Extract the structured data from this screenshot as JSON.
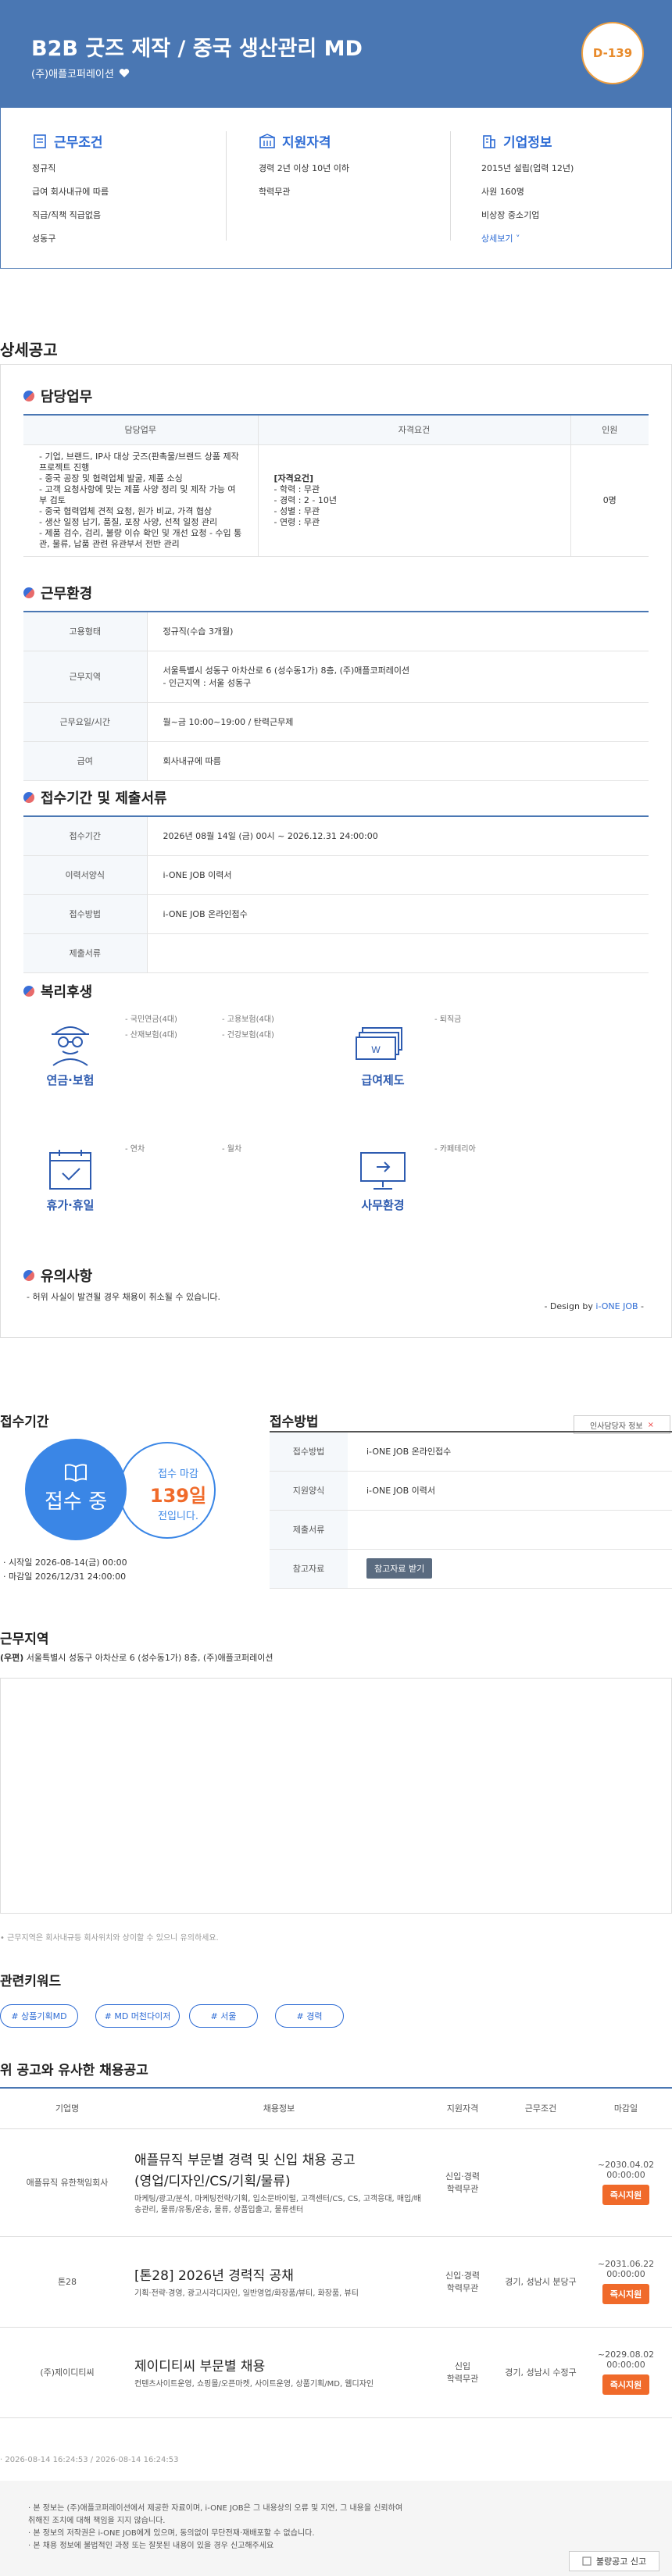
{
  "header": {
    "title": "B2B 굿즈 제작 / 중국 생산관리 MD",
    "company": "(주)애플코퍼레이션",
    "dday": "D-139"
  },
  "summary": {
    "conditions": {
      "title": "근무조건",
      "lines": [
        "정규직",
        "급여 회사내규에 따름",
        "직급/직책 직급없음",
        "성동구"
      ]
    },
    "qualification": {
      "title": "지원자격",
      "lines": [
        "경력 2년 이상 10년 이하",
        "학력무관"
      ]
    },
    "company": {
      "title": "기업정보",
      "lines": [
        "2015년 설립(업력 12년)",
        "사원 160명",
        "비상장 중소기업"
      ],
      "more": "상세보기"
    }
  },
  "detail": {
    "section_title": "상세공고",
    "duty": {
      "title": "담당업무",
      "headers": [
        "담당업무",
        "자격요건",
        "인원"
      ],
      "task": [
        "- 기업, 브랜드, IP사 대상 굿즈(판촉물/브랜드 상품 제작",
        "  프로젝트 진행",
        "- 중국 공장 및 협력업체 발굴, 제품 소싱",
        "- 고객 요청사항에 맞는 제품 사양 정리 및 제작 가능 여",
        "  부 검토",
        "- 중국 협력업체 견적 요청, 원가 비교, 가격 협상",
        "- 생산 일정 납기, 품질, 포장 사양, 선적 일정 관리",
        "- 제품 검수, 검리, 불량 이슈 확인 및 개선 요청 - 수입 통",
        "  관, 물류, 납품 관련 유관부서 전반 관리"
      ],
      "qual_title": "[자격요건]",
      "qual": [
        "- 학력 : 무관",
        "- 경력 : 2 - 10년",
        "- 성별 : 무관",
        "- 연령 : 무관"
      ],
      "count": "0명"
    },
    "work_env": {
      "title": "근무환경",
      "rows": [
        {
          "k": "고용형태",
          "v": "정규직(수습 3개월)"
        },
        {
          "k": "근무지역",
          "v": "서울특별시 성동구 아차산로 6 (성수동1가) 8층, (주)애플코퍼레이션"
        },
        {
          "k": "근무요일/시간",
          "v": "월~금 10:00~19:00 / 탄력근무제"
        },
        {
          "k": "급여",
          "v": "회사내규에 따름"
        }
      ],
      "work_area_sub": "- 인근지역 : 서울 성동구"
    },
    "period": {
      "title": "접수기간 및 제출서류",
      "rows": [
        {
          "k": "접수기간",
          "v": "2026년 08월 14일 (금) 00시 ~ 2026.12.31 24:00:00"
        },
        {
          "k": "이력서양식",
          "v": "i-ONE JOB 이력서"
        },
        {
          "k": "접수방법",
          "v": "i-ONE JOB 온라인접수"
        },
        {
          "k": "제출서류",
          "v": ""
        }
      ]
    },
    "welfare": {
      "title": "복리후생",
      "pension": {
        "label": "연금·보험",
        "items": [
          "- 국민연금(4대)",
          "- 산재보험(4대)",
          "- 고용보험(4대)",
          "- 건강보험(4대)"
        ]
      },
      "salary": {
        "label": "급여제도",
        "items": [
          "- 퇴직금"
        ]
      },
      "vacation": {
        "label": "휴가·휴일",
        "items": [
          "- 연차",
          "- 월차"
        ]
      },
      "office": {
        "label": "사무환경",
        "items": [
          "- 카페테리아"
        ]
      }
    },
    "notice": {
      "title": "유의사항",
      "text": "- 허위 사실이 발견될 경우 채용이 취소될 수 있습니다.",
      "design_prefix": "- Design by ",
      "design_brand": "i-ONE JOB",
      "design_suffix": " -"
    }
  },
  "apply": {
    "period_title": "접수기간",
    "status": "접수 중",
    "deadline_label": "접수 마감",
    "deadline_days": "139일",
    "deadline_suffix": "전입니다.",
    "start": "· 시작일 2026-08-14(금) 00:00",
    "end": "· 마감일 2026/12/31 24:00:00",
    "method_title": "접수방법",
    "contact_button": "인사담당자 정보",
    "rows": [
      {
        "k": "접수방법",
        "v": "i-ONE JOB 온라인접수"
      },
      {
        "k": "지원양식",
        "v": "i-ONE JOB 이력서"
      },
      {
        "k": "제출서류",
        "v": ""
      },
      {
        "k": "참고자료",
        "v": ""
      }
    ],
    "download_button": "참고자료 받기"
  },
  "location": {
    "title": "근무지역",
    "badge": "(우편)",
    "address": "서울특별시 성동구 아차산로 6 (성수동1가) 8층, (주)애플코퍼레이션",
    "note": "• 근무지역은 회사내규등 회사위치와 상이할 수 있으니 유의하세요."
  },
  "keywords": {
    "title": "관련키워드",
    "items": [
      "# 상품기획MD",
      "# MD 머천다이저",
      "# 서울",
      "# 경력"
    ]
  },
  "similar": {
    "title": "위 공고와 유사한 채용공고",
    "headers": [
      "기업명",
      "채용정보",
      "지원자격",
      "근무조건",
      "마감일"
    ],
    "rows": [
      {
        "company": "애플뮤직 유한책임회사",
        "title1": "애플뮤직 부문별 경력 및 신입 채용 공고",
        "title2": "(영업/디자인/CS/기획/물류)",
        "desc": "마케팅/광고/분석, 마케팅전략/기획, 입소문바이럴, 고객센터/CS, CS, 고객응대, 매입/배송관리, 물류/유통/운송, 물류, 상품입출고, 물류센터",
        "qual": "신입·경력\n학력무관",
        "cond": "",
        "deadline": "~2030.04.02 00:00:00",
        "btn": "즉시지원"
      },
      {
        "company": "톤28",
        "title1": "[톤28] 2026년 경력직 공채",
        "title2": "",
        "desc": "기획·전략·경영, 광고시각디자인, 일반영업/화장품/뷰티, 화장품, 뷰티",
        "qual": "신입·경력\n학력무관",
        "cond": "경기, 성남시 분당구",
        "deadline": "~2031.06.22 00:00:00",
        "btn": "즉시지원"
      },
      {
        "company": "(주)제이디티씨",
        "title1": "제이디티씨 부문별 채용",
        "title2": "",
        "desc": "컨텐츠사이트운영, 쇼핑몰/오픈마켓, 사이트운영, 상품기획/MD, 웹디자인",
        "qual": "신입\n학력무관",
        "cond": "경기, 성남시 수정구",
        "deadline": "~2029.08.02 00:00:00",
        "btn": "즉시지원"
      }
    ],
    "timestamp": "· 2026-08-14 16:24:53 / 2026-08-14 16:24:53"
  },
  "footer": {
    "lines": [
      "· 본 정보는 (주)애플코퍼레이션에서 제공한 자료이며, i-ONE JOB은 그 내용상의 오류 및 지연, 그 내용을 신뢰하여",
      "  취해진 조치에 대해 책임을 지지 않습니다.",
      "· 본 정보의 저작권은 i-ONE JOB에게 있으며, 동의없이 무단전재·재배포할 수 없습니다.",
      "· 본 채용 정보에 불법적인 과정 또는 잘못된 내용이 있을 경우 신고해주세요"
    ],
    "report_button": "불량공고 신고"
  },
  "colors": {
    "primary": "#4a77b3",
    "accent": "#2d6bd4",
    "orange": "#f06a2a"
  }
}
